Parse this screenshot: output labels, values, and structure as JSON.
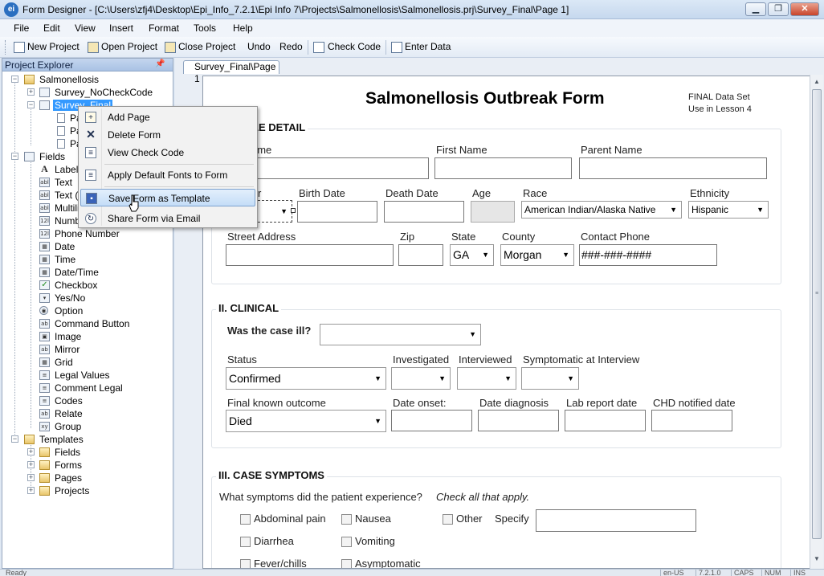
{
  "window": {
    "title": "Form Designer - [C:\\Users\\zfj4\\Desktop\\Epi_Info_7.2.1\\Epi Info 7\\Projects\\Salmonellosis\\Salmonellosis.prj\\Survey_Final\\Page 1]",
    "app_icon": "ei"
  },
  "menu": [
    "File",
    "Edit",
    "View",
    "Insert",
    "Format",
    "Tools",
    "Help"
  ],
  "toolbar": {
    "new_project": "New Project",
    "open_project": "Open Project",
    "close_project": "Close Project",
    "undo": "Undo",
    "redo": "Redo",
    "check_code": "Check Code",
    "enter_data": "Enter Data"
  },
  "explorer": {
    "title": "Project Explorer",
    "project": "Salmonellosis",
    "forms": [
      "Survey_NoCheckCode",
      "Survey_Final"
    ],
    "pages": [
      "Pa",
      "Pa",
      "Pa"
    ],
    "fields_header": "Fields",
    "fields": [
      {
        "label": "Label/",
        "icon": "A"
      },
      {
        "label": "Text",
        "icon": "abl"
      },
      {
        "label": "Text (I",
        "icon": "abl"
      },
      {
        "label": "Multili",
        "icon": "abl"
      },
      {
        "label": "Numbe",
        "icon": "12l"
      },
      {
        "label": "Phone Number",
        "icon": "12l"
      },
      {
        "label": "Date",
        "icon": "cal"
      },
      {
        "label": "Time",
        "icon": "cal"
      },
      {
        "label": "Date/Time",
        "icon": "cal"
      },
      {
        "label": "Checkbox",
        "icon": "✓"
      },
      {
        "label": "Yes/No",
        "icon": "▾"
      },
      {
        "label": "Option",
        "icon": "◉"
      },
      {
        "label": "Command Button",
        "icon": "ab"
      },
      {
        "label": "Image",
        "icon": "img"
      },
      {
        "label": "Mirror",
        "icon": "ab"
      },
      {
        "label": "Grid",
        "icon": "grid"
      },
      {
        "label": "Legal Values",
        "icon": "≡"
      },
      {
        "label": "Comment Legal",
        "icon": "≡"
      },
      {
        "label": "Codes",
        "icon": "≡"
      },
      {
        "label": "Relate",
        "icon": "ab"
      },
      {
        "label": "Group",
        "icon": "xy"
      }
    ],
    "templates_header": "Templates",
    "templates": [
      "Fields",
      "Forms",
      "Pages",
      "Projects"
    ]
  },
  "tab": {
    "label": "Survey_Final\\Page 1"
  },
  "context_menu": {
    "items": [
      "Add Page",
      "Delete Form",
      "View Check Code",
      "Apply Default Fonts to Form",
      "Save Form as Template",
      "Share Form via Email"
    ],
    "hovered": "Save Form as Template"
  },
  "form": {
    "title": "Salmonellosis Outbreak Form",
    "note_line1": "FINAL Data Set",
    "note_line2": "Use in Lesson 4",
    "section1": "LE DETAIL",
    "last_name_fragment": "ame",
    "first_name": "First Name",
    "parent_name": "Parent Name",
    "sex_fragment": "r",
    "sex_value_fragment": "le",
    "birth_date": "Birth Date",
    "death_date": "Death Date",
    "age": "Age",
    "race": "Race",
    "race_value": "American Indian/Alaska Native",
    "ethnicity": "Ethnicity",
    "ethnicity_value": "Hispanic",
    "street": "Street Address",
    "zip": "Zip",
    "state": "State",
    "state_value": "GA",
    "county": "County",
    "county_value": "Morgan",
    "contact_phone": "Contact Phone",
    "phone_mask": "###-###-####",
    "section2": "II. CLINICAL",
    "ill_question": "Was the case ill?",
    "status": "Status",
    "status_value": "Confirmed",
    "investigated": "Investigated",
    "interviewed": "Interviewed",
    "symptomatic": "Symptomatic at Interview",
    "outcome": "Final known outcome",
    "outcome_value": "Died",
    "date_onset": "Date onset:",
    "date_diagnosis": "Date diagnosis",
    "lab_report": "Lab report date",
    "chd_notified": "CHD notified date",
    "section3": "III. CASE SYMPTOMS",
    "symptoms_question": "What symptoms did the patient experience?",
    "symptoms_hint": "Check all that apply.",
    "symptoms": [
      "Abdominal pain",
      "Nausea",
      "Other",
      "Diarrhea",
      "Vomiting",
      "Fever/chills",
      "Asymptomatic"
    ],
    "specify": "Specify"
  },
  "status_bar": {
    "left": "Ready",
    "lang": "en-US",
    "version": "7.2.1.0",
    "caps": "CAPS",
    "num": "NUM",
    "ins": "INS"
  }
}
